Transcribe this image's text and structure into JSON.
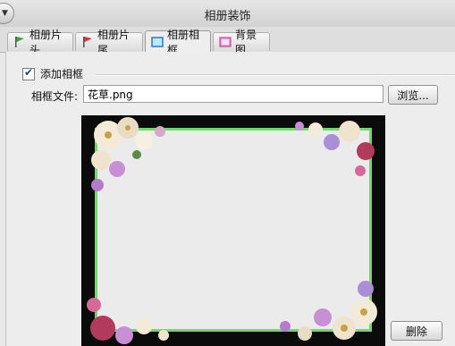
{
  "window": {
    "title": "相册装饰"
  },
  "tabs": [
    {
      "label": "相册片头",
      "icon": "green-flag-icon"
    },
    {
      "label": "相册片尾",
      "icon": "red-flag-icon"
    },
    {
      "label": "相册相框",
      "icon": "frame-icon",
      "active": true
    },
    {
      "label": "背景图",
      "icon": "pink-picture-icon"
    }
  ],
  "frame": {
    "add_frame_label": "添加相框",
    "add_frame_checked": true,
    "file_label": "相框文件:",
    "file_value": "花草.png",
    "browse_label": "浏览...",
    "delete_label": "删除"
  },
  "colors": {
    "frame_border": "#6fd96a",
    "preview_bg": "#0b0b0b",
    "frame_inner": "#ebebeb"
  }
}
